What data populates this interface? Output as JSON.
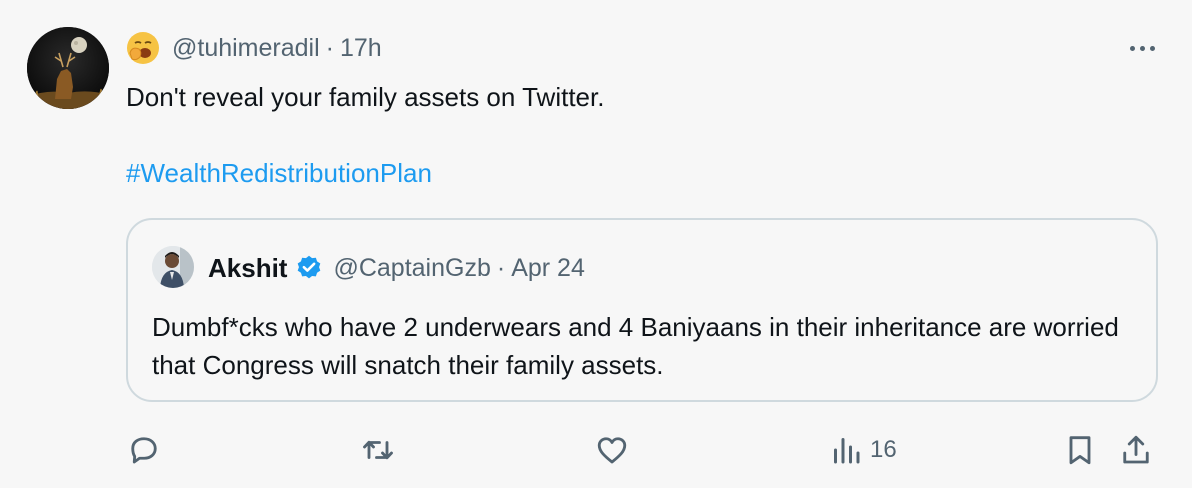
{
  "tweet": {
    "author_emoji": "yawning-face-emoji",
    "handle": "@tuhimeradil",
    "separator": "·",
    "time": "17h",
    "text_line_1": "Don't reveal your family assets on Twitter.",
    "hashtag": "#WealthRedistributionPlan"
  },
  "quote": {
    "name": "Akshit",
    "verified": true,
    "handle": "@CaptainGzb",
    "separator": "·",
    "date": "Apr 24",
    "text": "Dumbf*cks who have 2 underwears and 4 Baniyaans in their inheritance are worried that Congress will snatch their family assets."
  },
  "actions": {
    "reply_icon": "reply-icon",
    "retweet_icon": "retweet-icon",
    "like_icon": "heart-icon",
    "views_icon": "analytics-icon",
    "views_count": "16",
    "bookmark_icon": "bookmark-icon",
    "share_icon": "share-icon"
  },
  "colors": {
    "background": "#f7f7f7",
    "text": "#0f1419",
    "secondary": "#536471",
    "link": "#1d9bf0",
    "border": "#cfd9de",
    "verified": "#1d9bf0"
  }
}
